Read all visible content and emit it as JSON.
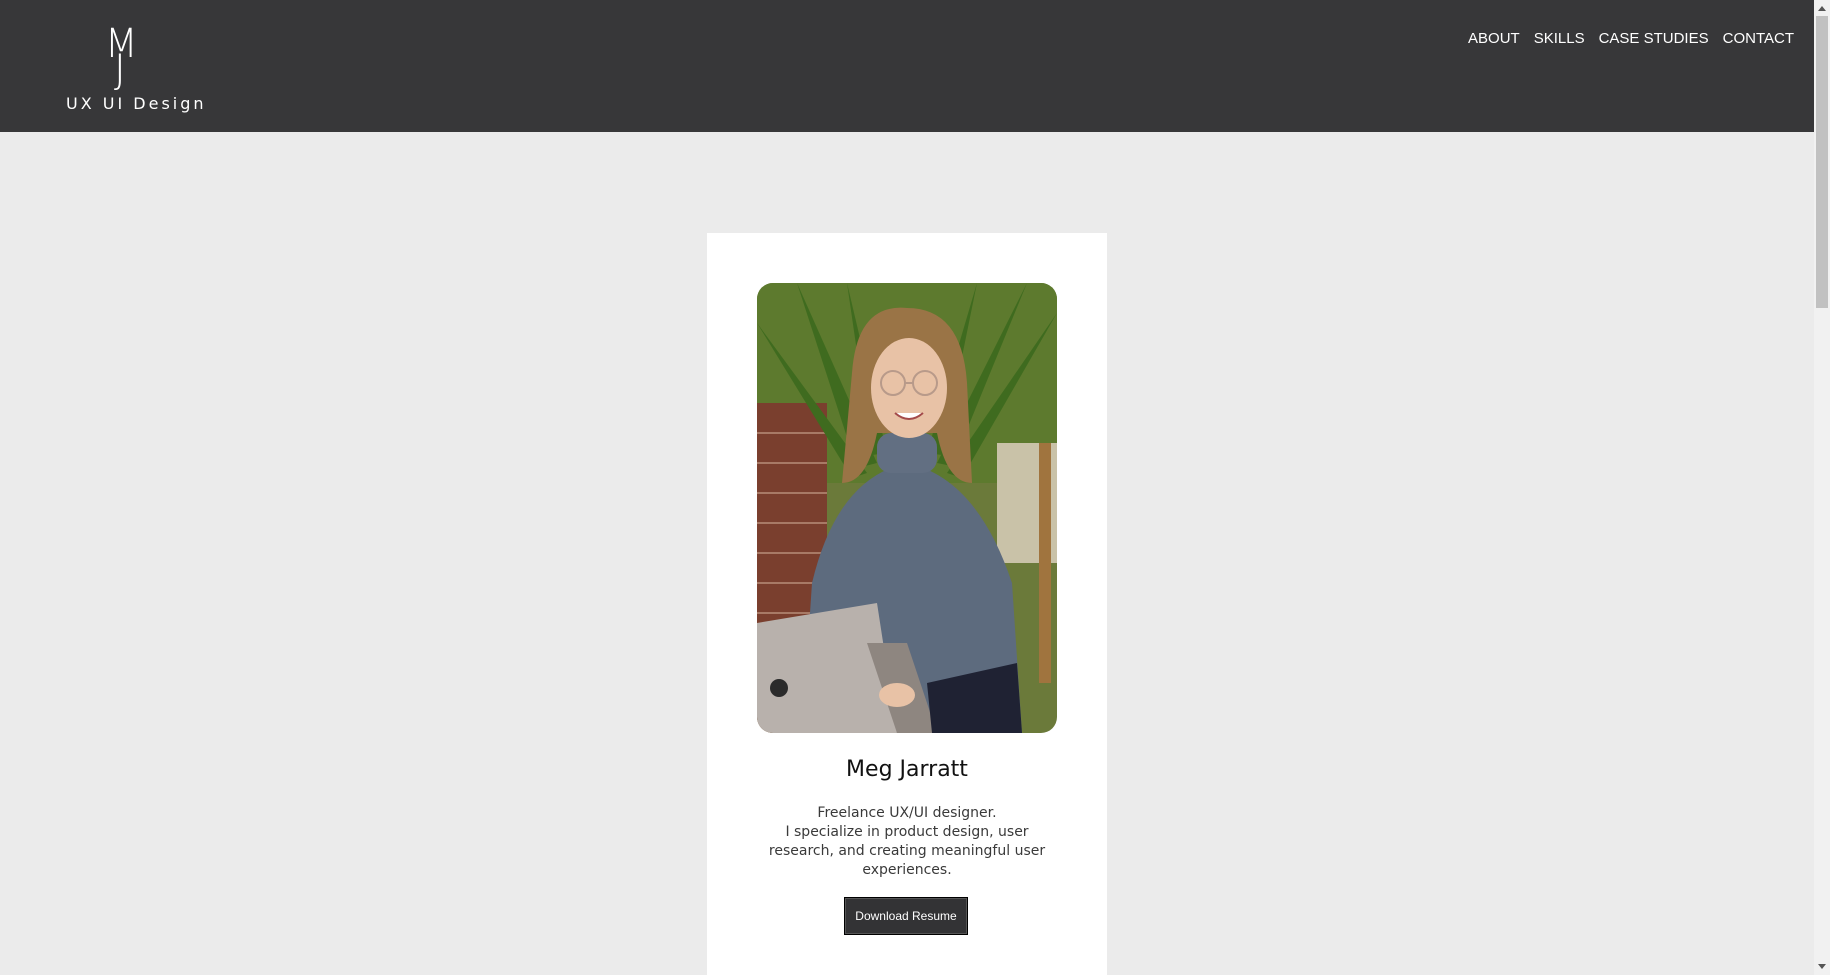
{
  "header": {
    "logo": {
      "mark_top": "M",
      "mark_bottom": "J",
      "text": "UX UI Design"
    },
    "nav": [
      {
        "label": "ABOUT"
      },
      {
        "label": "SKILLS"
      },
      {
        "label": "CASE STUDIES"
      },
      {
        "label": "CONTACT"
      }
    ]
  },
  "profile": {
    "name": "Meg Jarratt",
    "bio_lines": [
      "Freelance UX/UI designer.",
      "I specialize in product design, user",
      "research, and creating meaningful user",
      "experiences."
    ],
    "button_label": "Download Resume",
    "photo_alt": "profile photo"
  },
  "colors": {
    "header_bg": "#373739",
    "page_bg": "#ebebeb",
    "card_bg": "#ffffff",
    "button_bg": "#333335"
  }
}
